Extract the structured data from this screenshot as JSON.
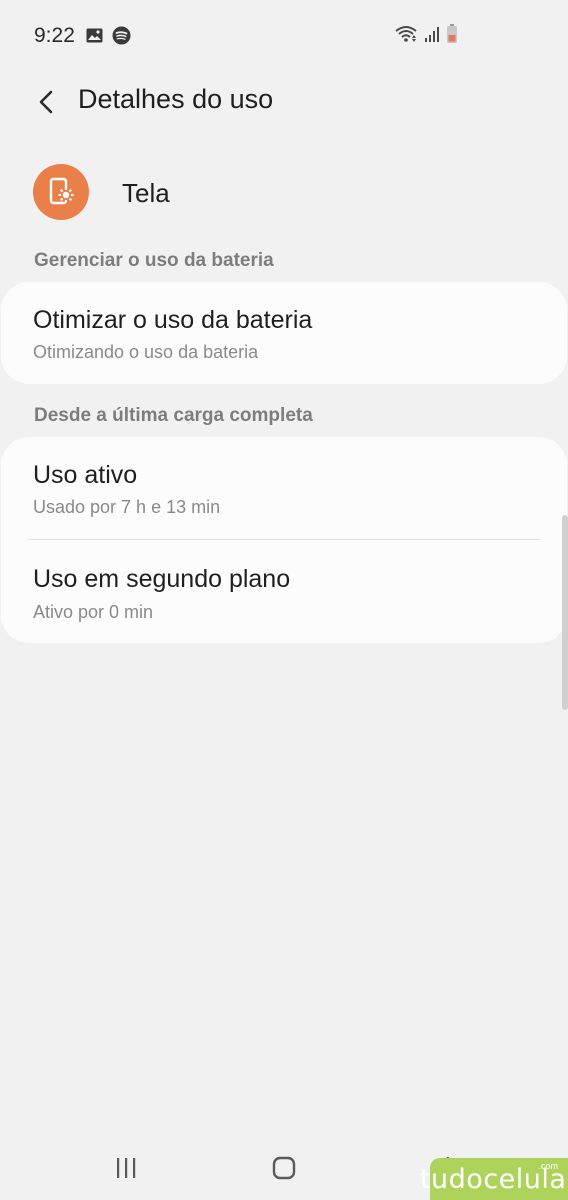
{
  "status_bar": {
    "time": "9:22",
    "left_icons": [
      "gallery-icon",
      "spotify-icon"
    ],
    "right_icons": [
      "wifi-icon",
      "signal-icon",
      "battery-icon"
    ]
  },
  "app_bar": {
    "title": "Detalhes do uso"
  },
  "app_header": {
    "name": "Tela",
    "icon": "screen-settings-icon",
    "icon_color": "#e9804a"
  },
  "sections": {
    "manage": {
      "heading": "Gerenciar o uso da bateria",
      "items": [
        {
          "title": "Otimizar o uso da bateria",
          "subtitle": "Otimizando o uso da bateria"
        }
      ]
    },
    "since_charge": {
      "heading": "Desde a última carga completa",
      "items": [
        {
          "title": "Uso ativo",
          "subtitle": "Usado por 7 h e 13 min"
        },
        {
          "title": "Uso em segundo plano",
          "subtitle": "Ativo por 0 min"
        }
      ]
    }
  },
  "nav_bar": {
    "buttons": [
      "recent-apps-icon",
      "home-icon",
      "back-icon"
    ]
  },
  "watermark": {
    "text": "tudocelular",
    "suffix": ".com",
    "color": "#aed35a"
  }
}
